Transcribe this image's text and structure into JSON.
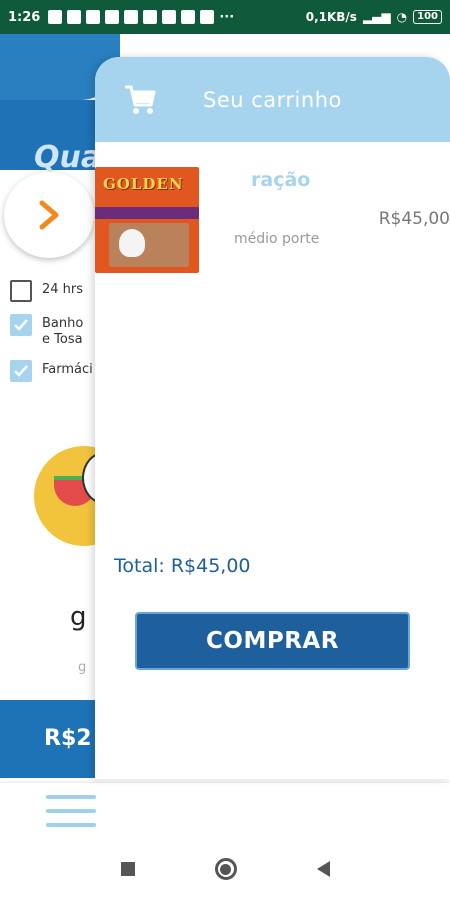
{
  "status_bar": {
    "time": "1:26",
    "network_speed": "0,1KB/s",
    "battery": "100"
  },
  "background": {
    "title_fragment": "Qua",
    "filters": [
      {
        "label": "24 hrs",
        "checked": false
      },
      {
        "label": "Banho\ne Tosa",
        "checked": true
      },
      {
        "label": "Farmáci",
        "checked": true
      }
    ],
    "product_name_fragment": "g",
    "product_sub_fragment": "g",
    "price_fragment": "R$2"
  },
  "cart": {
    "title": "Seu carrinho",
    "items": [
      {
        "name": "ração",
        "description": "médio porte",
        "price": "R$45,00",
        "image_brand": "GOLDEN"
      }
    ],
    "total_label": "Total:",
    "total_value": "R$45,00",
    "buy_label": "COMPRAR"
  },
  "colors": {
    "accent_light": "#a6d3ee",
    "accent_dark": "#1e5f9e",
    "status_bar": "#0f5a3a"
  }
}
